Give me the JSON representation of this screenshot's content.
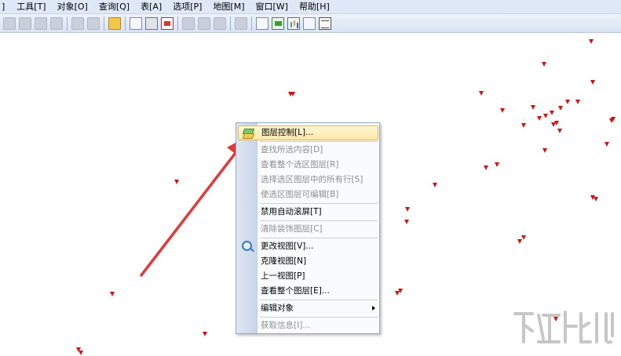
{
  "menubar": {
    "items": [
      "]",
      "工具[T]",
      "对象[O]",
      "查询[Q]",
      "表[A]",
      "选项[P]",
      "地图[M]",
      "窗口[W]",
      "帮助[H]"
    ]
  },
  "toolbar": {
    "icons": [
      "pan-icon",
      "select-icon",
      "zoom-in-icon",
      "zoom-out-icon",
      "save-icon",
      "save-copy-icon",
      "open-folder-icon",
      "print-preview-icon",
      "print-icon",
      "pdf-icon",
      "cut-icon",
      "copy-icon",
      "paste-icon",
      "undo-icon",
      "table-icon",
      "chart-icon",
      "graph-icon",
      "layout-icon",
      "grid-icon"
    ]
  },
  "context_menu": {
    "items": [
      {
        "label": "图层控制[L]...",
        "enabled": true,
        "highlighted": true,
        "icon": "layers-icon"
      },
      {
        "label": "查找所选内容[D]",
        "enabled": false
      },
      {
        "label": "查看整个选区图层[R]",
        "enabled": false
      },
      {
        "label": "选择选区图层中的所有行[S]",
        "enabled": false
      },
      {
        "label": "使选区图层可编辑[B]",
        "enabled": false
      },
      {
        "label": "禁用自动滚屏[T]",
        "enabled": true
      },
      {
        "label": "清除装饰图层[C]",
        "enabled": false
      },
      {
        "label": "更改视图[V]...",
        "enabled": true,
        "icon": "zoom-icon"
      },
      {
        "label": "克隆视图[N]",
        "enabled": true
      },
      {
        "label": "上一视图[P]",
        "enabled": true
      },
      {
        "label": "查看整个图层[E]...",
        "enabled": true
      },
      {
        "label": "编辑对象",
        "enabled": true,
        "submenu": true
      },
      {
        "label": "获取信息[I]...",
        "enabled": false
      }
    ]
  },
  "colors": {
    "map_point": "#d21414",
    "arrow": "#e23a3a",
    "menu_highlight": "#fde8a8"
  }
}
